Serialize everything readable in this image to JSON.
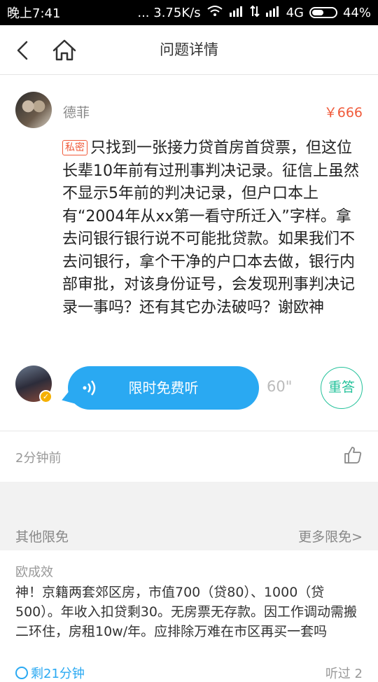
{
  "status_bar": {
    "time": "晚上7:41",
    "speed": "... 3.75K/s",
    "network": "4G",
    "battery": "44%"
  },
  "nav": {
    "title": "问题详情",
    "back_icon": "chevron-left-icon",
    "home_icon": "home-icon"
  },
  "question": {
    "asker_name": "德菲",
    "price": "￥666",
    "tag": "私密",
    "text": "只找到一张接力贷首房首贷票，但这位长辈10年前有过刑事判决记录。征信上虽然不显示5年前的判决记录，但户口本上有“2004年从xx第一看守所迁入”字样。拿去问银行银行说不可能批贷款。如果我们不去问银行，拿个干净的户口本去做，银行内部审批，对该身份证号，会发现刑事判决记录一事吗？还有其它办法破吗？谢欧神"
  },
  "answer": {
    "listen_label": "限时免费听",
    "duration": "60\"",
    "reanswer_label": "重答"
  },
  "meta": {
    "time_ago": "2分钟前",
    "like_icon": "thumbs-up-icon"
  },
  "other": {
    "title": "其他限免",
    "more_label": "更多限免>"
  },
  "card": {
    "name": "欧成效",
    "text": "神！京籍两套郊区房，市值700（贷80）、1000（贷500）。年收入扣贷剩30。无房票无存款。因工作调动需搬二环住，房租10w/年。应排除万难在市区再买一套吗",
    "left_label": "剩21分钟",
    "right_label": "听过 2"
  },
  "colors": {
    "accent_blue": "#2aa9f2",
    "price_red": "#f05a3a",
    "teal": "#25c29b"
  }
}
